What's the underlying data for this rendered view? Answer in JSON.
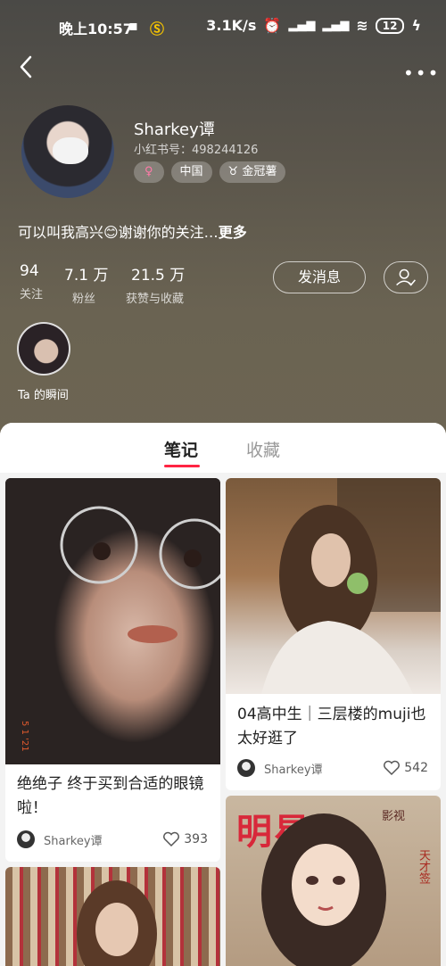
{
  "status": {
    "time": "晚上10:57",
    "speed": "3.1K/s",
    "battery": "12"
  },
  "profile": {
    "name": "Sharkey谭",
    "red_id": "小红书号：498244126",
    "tags": {
      "gender": "♀",
      "region": "中国",
      "badge": "金冠薯"
    },
    "bio": "可以叫我高兴😊谢谢你的关注…",
    "bio_more": "更多",
    "stats": [
      {
        "num": "94",
        "label": "关注"
      },
      {
        "num": "7.1 万",
        "label": "粉丝"
      },
      {
        "num": "21.5 万",
        "label": "获赞与收藏"
      }
    ],
    "message_button": "发消息",
    "moment_label": "Ta 的瞬间"
  },
  "tabs": {
    "notes": "笔记",
    "collections": "收藏"
  },
  "notes": [
    {
      "title": "绝绝子 终于买到合适的眼镜啦！",
      "author": "Sharkey谭",
      "likes": "393",
      "stamp": "5 1 '21"
    },
    {
      "title": "04高中生｜三层楼的muji也太好逛了",
      "author": "Sharkey谭",
      "likes": "542"
    },
    {
      "poster_title": "明星",
      "poster_side": "天才签",
      "poster_sub": "影视"
    }
  ],
  "colors": {
    "accent": "#ff2442",
    "header_top": "#4a4946",
    "header_bottom": "#6d6553"
  }
}
